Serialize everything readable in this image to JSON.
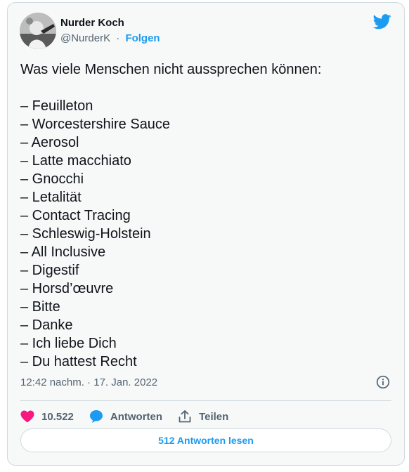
{
  "author": {
    "name": "Nurder Koch",
    "handle": "@NurderK",
    "separator": "·",
    "follow_label": "Folgen",
    "avatar_icon": "profile-photo-icon",
    "brand_icon": "twitter-bird-icon"
  },
  "tweet": {
    "intro": "Was viele Menschen nicht aussprechen können:",
    "items": [
      "– Feuilleton",
      "– Worcestershire Sauce",
      "– Aerosol",
      "– Latte macchiato",
      "– Gnocchi",
      "– Letalität",
      "– Contact Tracing",
      "– Schleswig-Holstein",
      "– All Inclusive",
      "– Digestif",
      "– Horsd’œuvre",
      "– Bitte",
      "– Danke",
      "– Ich liebe Dich",
      "– Du hattest Recht"
    ],
    "timestamp": "12:42 nachm. · 17. Jan. 2022",
    "info_icon": "info-icon"
  },
  "actions": {
    "like_count": "10.522",
    "reply_label": "Antworten",
    "share_label": "Teilen",
    "like_icon": "heart-icon",
    "reply_icon": "speech-bubble-icon",
    "share_icon": "share-icon"
  },
  "replies_button": {
    "label": "512 Antworten lesen"
  },
  "colors": {
    "accent": "#1d9bf0",
    "like": "#f91880",
    "muted": "#536471",
    "card_bg": "#f7f9f9",
    "border": "#cfd9de"
  }
}
